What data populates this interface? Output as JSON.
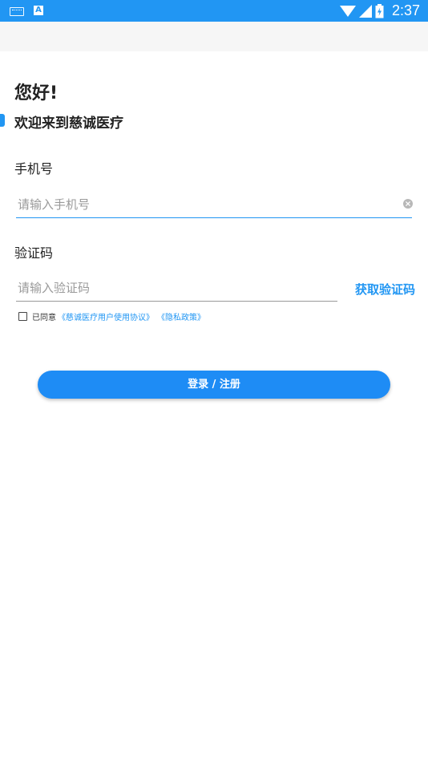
{
  "status_bar": {
    "time": "2:37",
    "font_icon_letter": "A",
    "icons": [
      "keyboard-icon",
      "font-icon",
      "wifi-icon",
      "signal-icon",
      "battery-icon"
    ]
  },
  "login": {
    "greeting": "您好!",
    "welcome": "欢迎来到慈诚医疗",
    "phone_label": "手机号",
    "phone_placeholder": "请输入手机号",
    "phone_value": "",
    "code_label": "验证码",
    "code_placeholder": "请输入验证码",
    "code_value": "",
    "get_code": "获取验证码",
    "agree_prefix": "已同意",
    "user_agreement_link": "《慈诚医疗用户使用协议》",
    "privacy_link": "《隐私政策》",
    "submit_label": "登录 / 注册",
    "agreement_checked": false
  },
  "colors": {
    "accent": "#2196f3",
    "button": "#1e8cf5",
    "status_bar": "#2196f3",
    "placeholder": "#9a9a9a",
    "text": "#222222"
  }
}
